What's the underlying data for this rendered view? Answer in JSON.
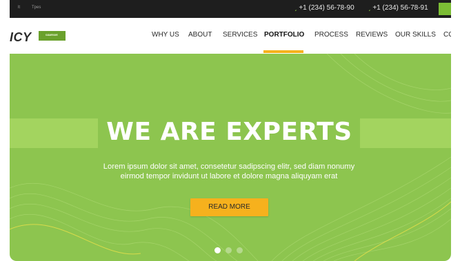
{
  "topbar": {
    "mini_left": "lt",
    "mini_right": "Tpes",
    "phones": [
      "+1 (234) 56-78-90",
      "+1 (234) 56-78-91"
    ]
  },
  "logo": {
    "text": "ICY",
    "badge_line1": "COMPANY",
    "badge_line2": "SALES DIE"
  },
  "nav": {
    "items": [
      "WHY US",
      "ABOUT",
      "SERVICES",
      "PORTFOLIO",
      "PROCESS",
      "REVIEWS",
      "OUR SKILLS",
      "CO"
    ],
    "active": "PORTFOLIO"
  },
  "hero": {
    "title": "WE ARE EXPERTS",
    "subtitle_line1": "Lorem ipsum dolor sit amet, consetetur sadipscing elitr, sed diam nonumy",
    "subtitle_line2": "eirmod tempor invidunt ut labore et dolore magna aliquyam erat",
    "button_label": "READ MORE",
    "slides_total": 3,
    "slide_active": 1
  },
  "colors": {
    "hero_green": "#8dc54f",
    "band_green": "#a3d45f",
    "accent_orange": "#f6b11d",
    "topbar": "#1e1e1e"
  },
  "icons": [
    "phone-icon",
    "phone-icon"
  ]
}
